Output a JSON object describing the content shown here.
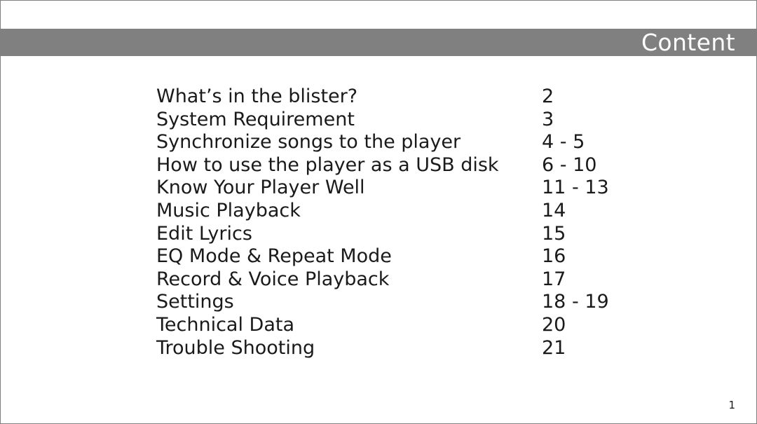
{
  "slide": {
    "header": {
      "title": "Content",
      "bar_color": "#808080",
      "title_color": "#ffffff"
    },
    "toc": {
      "entries": [
        {
          "label": "What’s in the blister?",
          "page": "2"
        },
        {
          "label": "System Requirement",
          "page": "3"
        },
        {
          "label": "Synchronize songs to the player",
          "page": "4 - 5"
        },
        {
          "label": "How to use the player as a USB disk",
          "page": "6 - 10"
        },
        {
          "label": "Know Your Player Well",
          "page": "11 - 13"
        },
        {
          "label": "Music Playback",
          "page": "14"
        },
        {
          "label": "Edit Lyrics",
          "page": "15"
        },
        {
          "label": "EQ Mode & Repeat Mode",
          "page": "16"
        },
        {
          "label": "Record & Voice Playback",
          "page": "17"
        },
        {
          "label": "Settings",
          "page": "18 - 19"
        },
        {
          "label": "Technical Data",
          "page": "20"
        },
        {
          "label": "Trouble Shooting",
          "page": "21"
        }
      ]
    },
    "footer": {
      "page_number": "1"
    },
    "colors": {
      "text": "#1a1a1a",
      "background": "#ffffff",
      "border": "#808080"
    }
  }
}
